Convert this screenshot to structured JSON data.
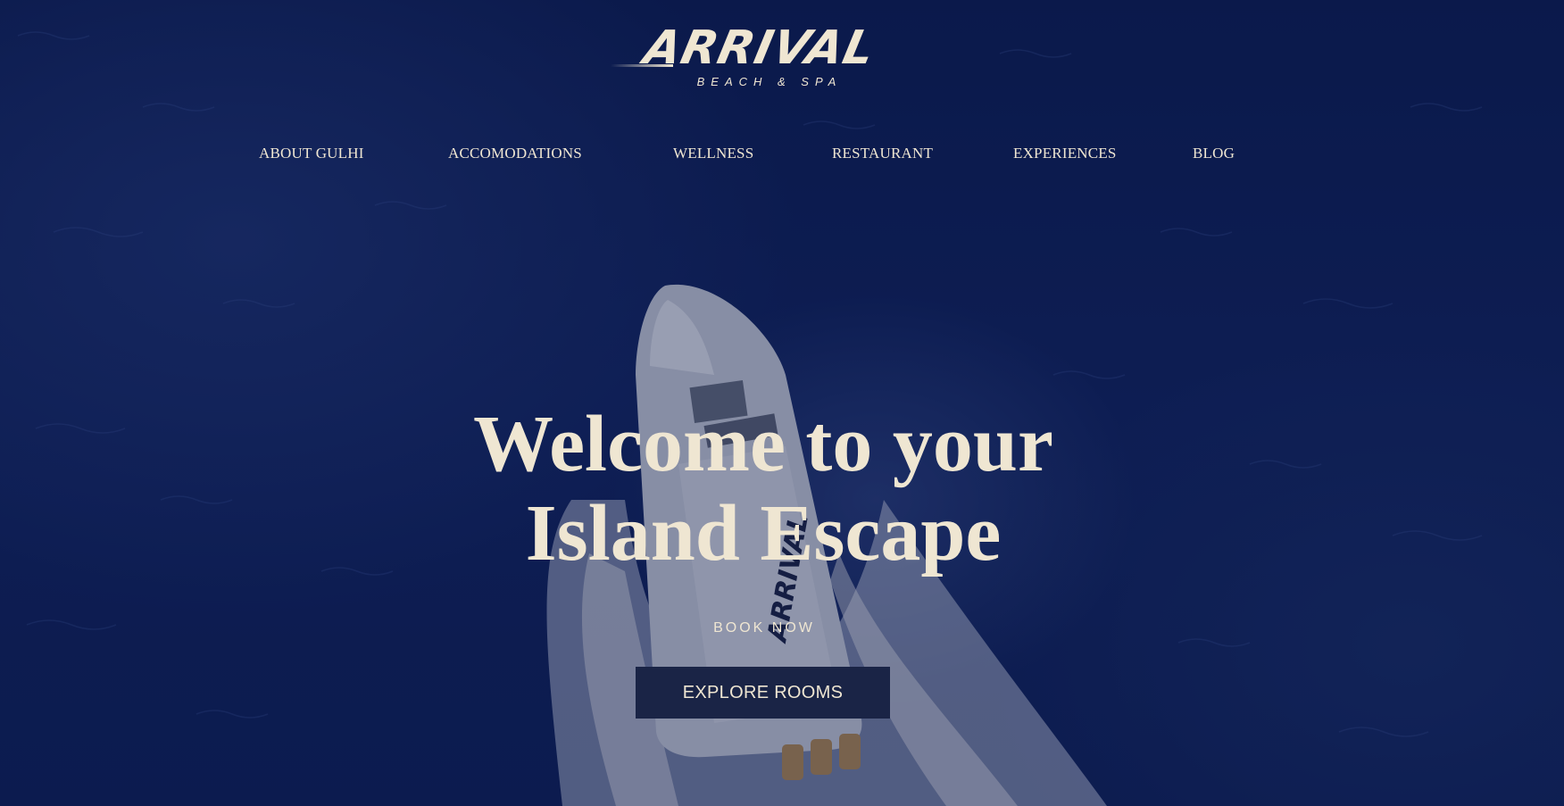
{
  "brand": {
    "name": "ARRIVAL",
    "tagline": "BEACH & SPA"
  },
  "nav": {
    "items": [
      {
        "label": "ABOUT GULHI"
      },
      {
        "label": "ACCOMODATIONS"
      },
      {
        "label": "WELLNESS"
      },
      {
        "label": "RESTAURANT"
      },
      {
        "label": "EXPERIENCES"
      },
      {
        "label": "BLOG"
      }
    ]
  },
  "hero": {
    "headline_line1": "Welcome to your",
    "headline_line2": "Island Escape",
    "book_now": "BOOK NOW",
    "explore_button": "EXPLORE ROOMS",
    "boat_hull_text": "ARRIVAL"
  },
  "colors": {
    "cream": "#efe6d2",
    "navy": "#0c1a4a",
    "button_bg": "#1a2446"
  }
}
